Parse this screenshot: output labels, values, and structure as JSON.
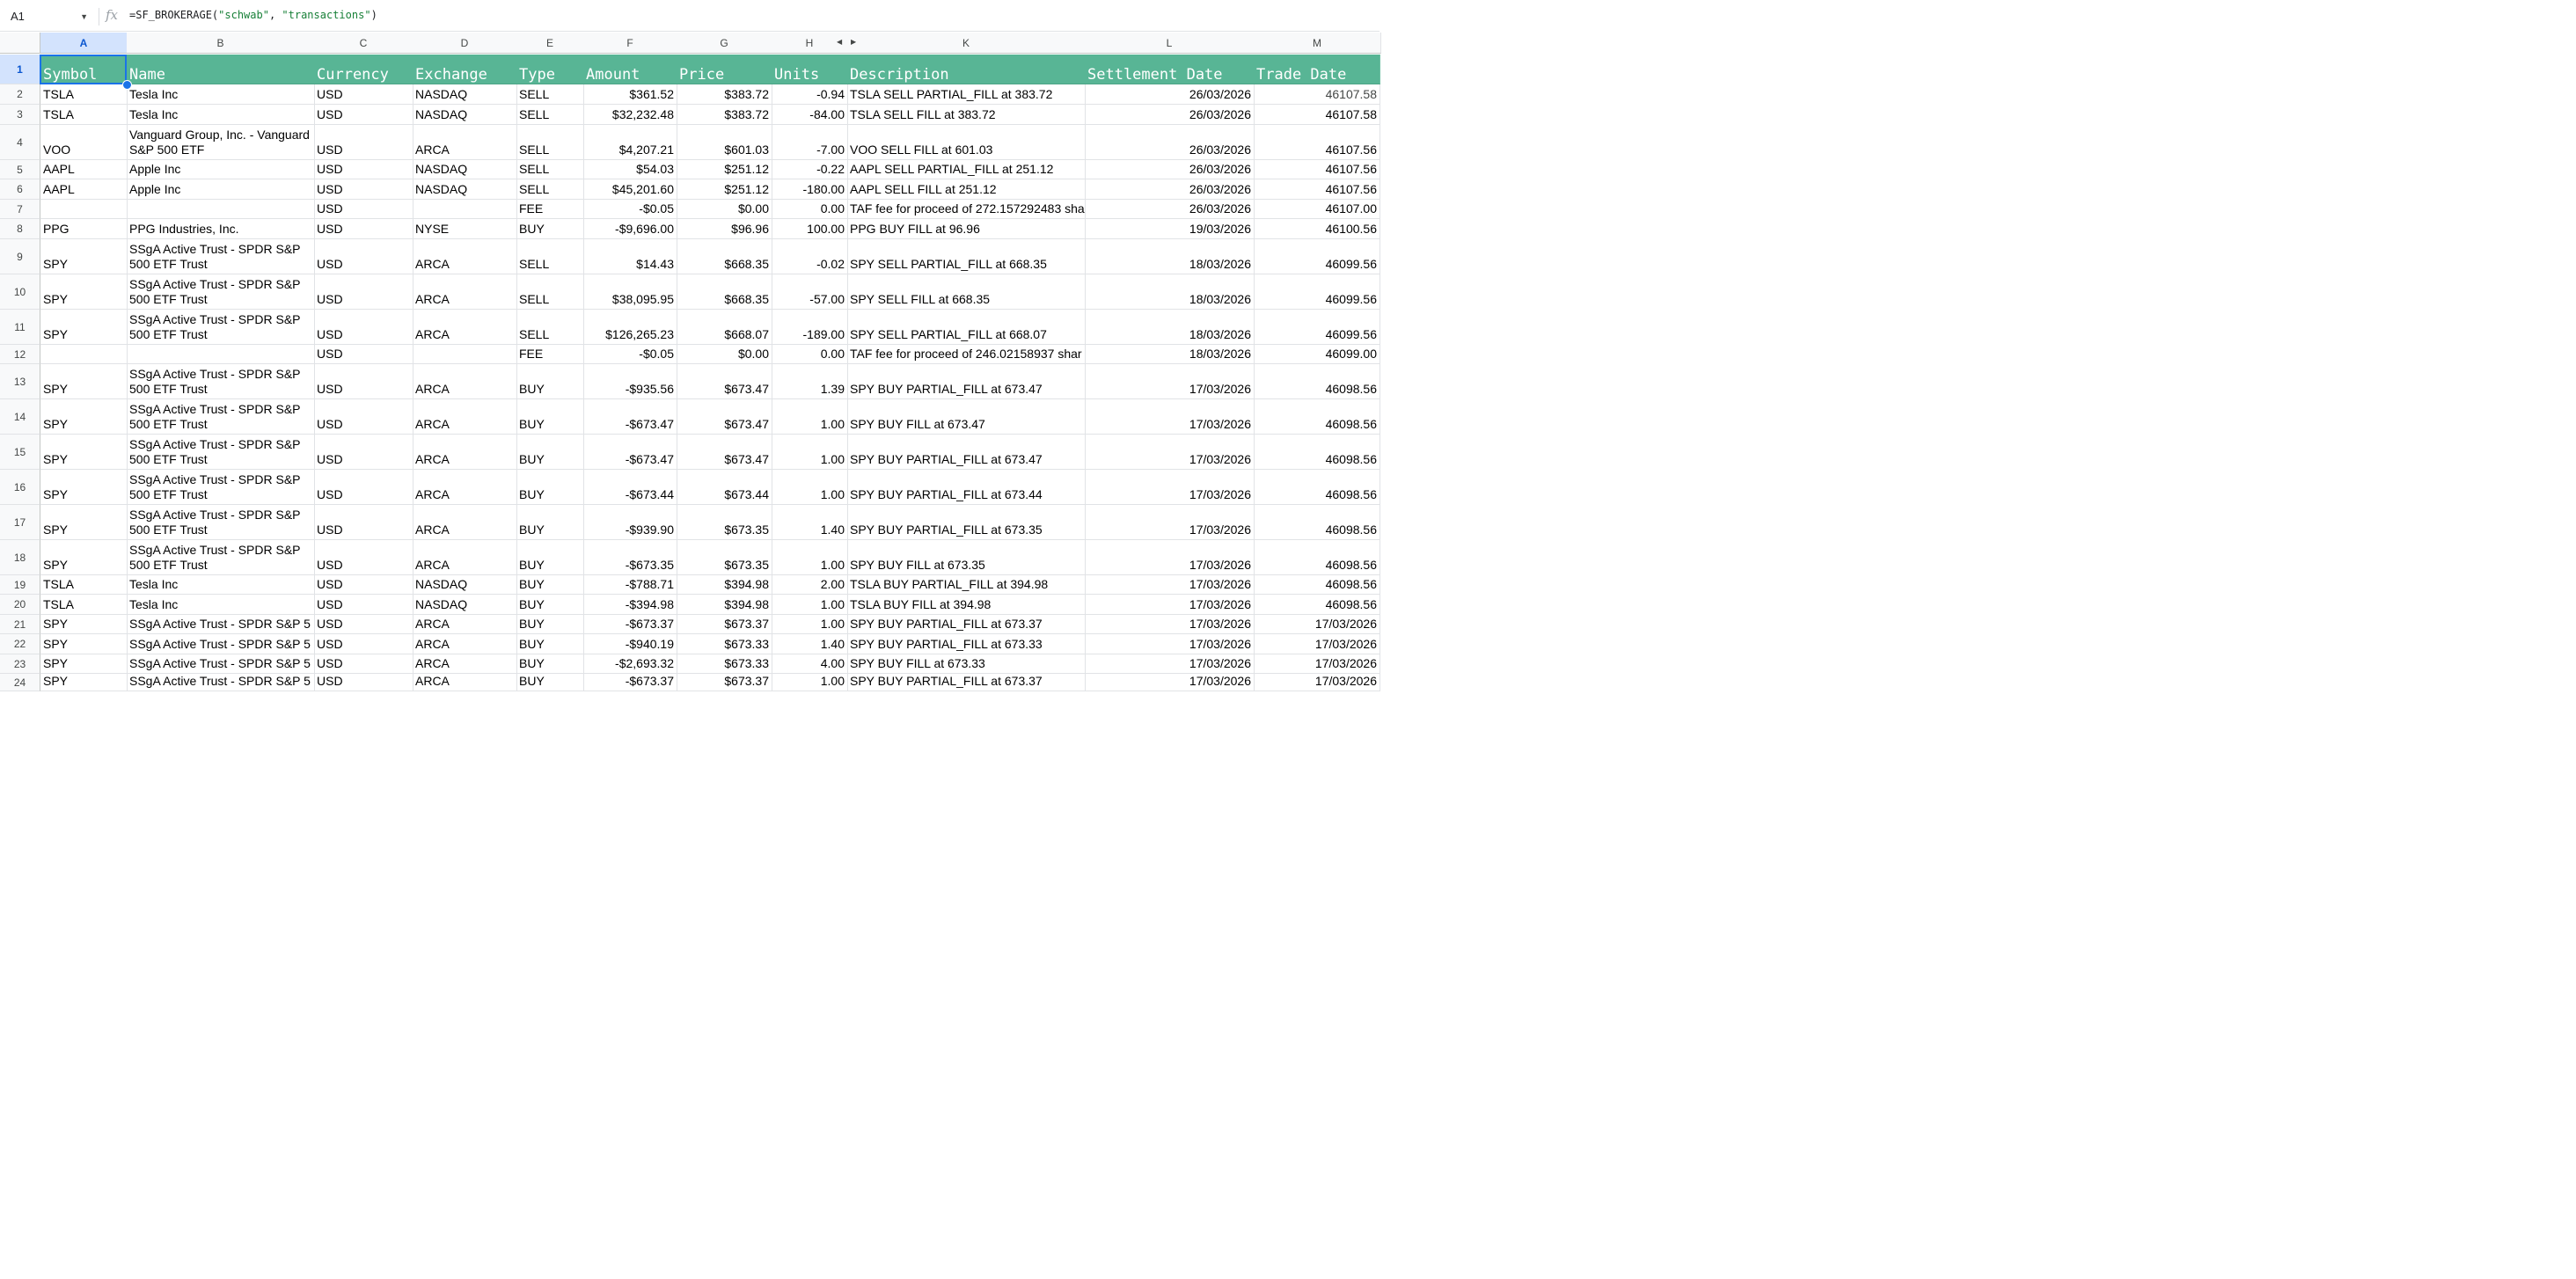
{
  "formula_bar": {
    "name_box": "A1",
    "fx": "fx",
    "formula_prefix": "=SF_BROKERAGE(",
    "formula_arg1": "\"schwab\"",
    "formula_sep": ", ",
    "formula_arg2": "\"transactions\"",
    "formula_suffix": ")"
  },
  "columns": [
    "A",
    "B",
    "C",
    "D",
    "E",
    "F",
    "G",
    "H",
    "K",
    "L",
    "M"
  ],
  "header_row": [
    "Symbol",
    "Name",
    "Currency",
    "Exchange",
    "Type",
    "Amount",
    "Price",
    "Units",
    "Description",
    "Settlement Date",
    "Trade Date"
  ],
  "rows": [
    {
      "n": "2",
      "c": [
        "TSLA",
        "Tesla Inc",
        "USD",
        "NASDAQ",
        "SELL",
        "$361.52",
        "$383.72",
        "-0.94",
        "TSLA SELL PARTIAL_FILL at 383.72",
        "26/03/2026",
        "46107.58"
      ]
    },
    {
      "n": "3",
      "c": [
        "TSLA",
        "Tesla Inc",
        "USD",
        "NASDAQ",
        "SELL",
        "$32,232.48",
        "$383.72",
        "-84.00",
        "TSLA SELL FILL at 383.72",
        "26/03/2026",
        "46107.58"
      ]
    },
    {
      "n": "4",
      "c": [
        "VOO",
        "Vanguard Group, Inc. - Vanguard S&P 500 ETF",
        "USD",
        "ARCA",
        "SELL",
        "$4,207.21",
        "$601.03",
        "-7.00",
        "VOO SELL FILL at 601.03",
        "26/03/2026",
        "46107.56"
      ]
    },
    {
      "n": "5",
      "c": [
        "AAPL",
        "Apple Inc",
        "USD",
        "NASDAQ",
        "SELL",
        "$54.03",
        "$251.12",
        "-0.22",
        "AAPL SELL PARTIAL_FILL at 251.12",
        "26/03/2026",
        "46107.56"
      ]
    },
    {
      "n": "6",
      "c": [
        "AAPL",
        "Apple Inc",
        "USD",
        "NASDAQ",
        "SELL",
        "$45,201.60",
        "$251.12",
        "-180.00",
        "AAPL SELL FILL at 251.12",
        "26/03/2026",
        "46107.56"
      ]
    },
    {
      "n": "7",
      "c": [
        "",
        "",
        "USD",
        "",
        "FEE",
        "-$0.05",
        "$0.00",
        "0.00",
        "TAF fee for proceed of 272.157292483 sha",
        "26/03/2026",
        "46107.00"
      ]
    },
    {
      "n": "8",
      "c": [
        "PPG",
        "PPG Industries, Inc.",
        "USD",
        "NYSE",
        "BUY",
        "-$9,696.00",
        "$96.96",
        "100.00",
        "PPG BUY FILL at 96.96",
        "19/03/2026",
        "46100.56"
      ]
    },
    {
      "n": "9",
      "c": [
        "SPY",
        "SSgA Active Trust - SPDR S&P 500 ETF Trust",
        "USD",
        "ARCA",
        "SELL",
        "$14.43",
        "$668.35",
        "-0.02",
        "SPY SELL PARTIAL_FILL at 668.35",
        "18/03/2026",
        "46099.56"
      ]
    },
    {
      "n": "10",
      "c": [
        "SPY",
        "SSgA Active Trust - SPDR S&P 500 ETF Trust",
        "USD",
        "ARCA",
        "SELL",
        "$38,095.95",
        "$668.35",
        "-57.00",
        "SPY SELL FILL at 668.35",
        "18/03/2026",
        "46099.56"
      ]
    },
    {
      "n": "11",
      "c": [
        "SPY",
        "SSgA Active Trust - SPDR S&P 500 ETF Trust",
        "USD",
        "ARCA",
        "SELL",
        "$126,265.23",
        "$668.07",
        "-189.00",
        "SPY SELL PARTIAL_FILL at 668.07",
        "18/03/2026",
        "46099.56"
      ]
    },
    {
      "n": "12",
      "c": [
        "",
        "",
        "USD",
        "",
        "FEE",
        "-$0.05",
        "$0.00",
        "0.00",
        "TAF fee for proceed of 246.02158937 shar",
        "18/03/2026",
        "46099.00"
      ]
    },
    {
      "n": "13",
      "c": [
        "SPY",
        "SSgA Active Trust - SPDR S&P 500 ETF Trust",
        "USD",
        "ARCA",
        "BUY",
        "-$935.56",
        "$673.47",
        "1.39",
        "SPY BUY PARTIAL_FILL at 673.47",
        "17/03/2026",
        "46098.56"
      ]
    },
    {
      "n": "14",
      "c": [
        "SPY",
        "SSgA Active Trust - SPDR S&P 500 ETF Trust",
        "USD",
        "ARCA",
        "BUY",
        "-$673.47",
        "$673.47",
        "1.00",
        "SPY BUY FILL at 673.47",
        "17/03/2026",
        "46098.56"
      ]
    },
    {
      "n": "15",
      "c": [
        "SPY",
        "SSgA Active Trust - SPDR S&P 500 ETF Trust",
        "USD",
        "ARCA",
        "BUY",
        "-$673.47",
        "$673.47",
        "1.00",
        "SPY BUY PARTIAL_FILL at 673.47",
        "17/03/2026",
        "46098.56"
      ]
    },
    {
      "n": "16",
      "c": [
        "SPY",
        "SSgA Active Trust - SPDR S&P 500 ETF Trust",
        "USD",
        "ARCA",
        "BUY",
        "-$673.44",
        "$673.44",
        "1.00",
        "SPY BUY PARTIAL_FILL at 673.44",
        "17/03/2026",
        "46098.56"
      ]
    },
    {
      "n": "17",
      "c": [
        "SPY",
        "SSgA Active Trust - SPDR S&P 500 ETF Trust",
        "USD",
        "ARCA",
        "BUY",
        "-$939.90",
        "$673.35",
        "1.40",
        "SPY BUY PARTIAL_FILL at 673.35",
        "17/03/2026",
        "46098.56"
      ]
    },
    {
      "n": "18",
      "c": [
        "SPY",
        "SSgA Active Trust - SPDR S&P 500 ETF Trust",
        "USD",
        "ARCA",
        "BUY",
        "-$673.35",
        "$673.35",
        "1.00",
        "SPY BUY FILL at 673.35",
        "17/03/2026",
        "46098.56"
      ]
    },
    {
      "n": "19",
      "c": [
        "TSLA",
        "Tesla Inc",
        "USD",
        "NASDAQ",
        "BUY",
        "-$788.71",
        "$394.98",
        "2.00",
        "TSLA BUY PARTIAL_FILL at 394.98",
        "17/03/2026",
        "46098.56"
      ]
    },
    {
      "n": "20",
      "c": [
        "TSLA",
        "Tesla Inc",
        "USD",
        "NASDAQ",
        "BUY",
        "-$394.98",
        "$394.98",
        "1.00",
        "TSLA BUY FILL at 394.98",
        "17/03/2026",
        "46098.56"
      ]
    },
    {
      "n": "21",
      "c": [
        "SPY",
        "SSgA Active Trust - SPDR S&P 5",
        "USD",
        "ARCA",
        "BUY",
        "-$673.37",
        "$673.37",
        "1.00",
        "SPY BUY PARTIAL_FILL at 673.37",
        "17/03/2026",
        "17/03/2026"
      ]
    },
    {
      "n": "22",
      "c": [
        "SPY",
        "SSgA Active Trust - SPDR S&P 5",
        "USD",
        "ARCA",
        "BUY",
        "-$940.19",
        "$673.33",
        "1.40",
        "SPY BUY PARTIAL_FILL at 673.33",
        "17/03/2026",
        "17/03/2026"
      ]
    },
    {
      "n": "23",
      "c": [
        "SPY",
        "SSgA Active Trust - SPDR S&P 5",
        "USD",
        "ARCA",
        "BUY",
        "-$2,693.32",
        "$673.33",
        "4.00",
        "SPY BUY FILL at 673.33",
        "17/03/2026",
        "17/03/2026"
      ]
    },
    {
      "n": "24",
      "c": [
        "SPY",
        "SSgA Active Trust - SPDR S&P 5",
        "USD",
        "ARCA",
        "BUY",
        "-$673.37",
        "$673.37",
        "1.00",
        "SPY BUY PARTIAL_FILL at 673.37",
        "17/03/2026",
        "17/03/2026"
      ]
    }
  ],
  "colors": {
    "header_fill": "#58b595",
    "selection": "#1a73e8",
    "grid": "#e1e3e6"
  },
  "icons": {
    "name_box_dropdown": "chevron-down-icon",
    "function": "fx-icon",
    "hidden_columns": "collapse-arrows-icon"
  }
}
